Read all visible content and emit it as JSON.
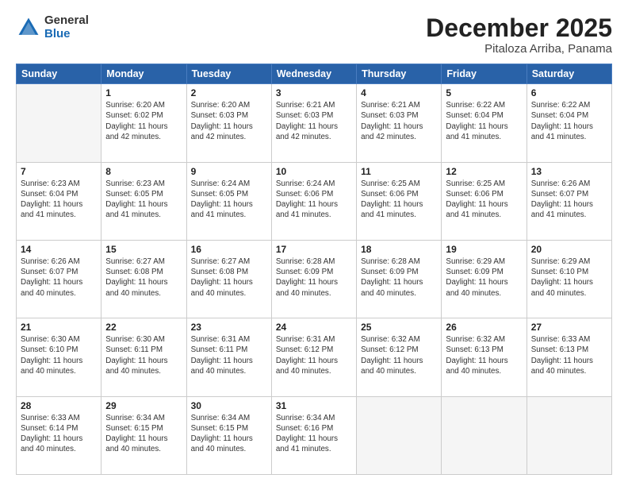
{
  "header": {
    "logo": {
      "general": "General",
      "blue": "Blue"
    },
    "title": "December 2025",
    "subtitle": "Pitaloza Arriba, Panama"
  },
  "weekdays": [
    "Sunday",
    "Monday",
    "Tuesday",
    "Wednesday",
    "Thursday",
    "Friday",
    "Saturday"
  ],
  "weeks": [
    [
      {
        "day": "",
        "info": ""
      },
      {
        "day": "1",
        "info": "Sunrise: 6:20 AM\nSunset: 6:02 PM\nDaylight: 11 hours\nand 42 minutes."
      },
      {
        "day": "2",
        "info": "Sunrise: 6:20 AM\nSunset: 6:03 PM\nDaylight: 11 hours\nand 42 minutes."
      },
      {
        "day": "3",
        "info": "Sunrise: 6:21 AM\nSunset: 6:03 PM\nDaylight: 11 hours\nand 42 minutes."
      },
      {
        "day": "4",
        "info": "Sunrise: 6:21 AM\nSunset: 6:03 PM\nDaylight: 11 hours\nand 42 minutes."
      },
      {
        "day": "5",
        "info": "Sunrise: 6:22 AM\nSunset: 6:04 PM\nDaylight: 11 hours\nand 41 minutes."
      },
      {
        "day": "6",
        "info": "Sunrise: 6:22 AM\nSunset: 6:04 PM\nDaylight: 11 hours\nand 41 minutes."
      }
    ],
    [
      {
        "day": "7",
        "info": "Sunrise: 6:23 AM\nSunset: 6:04 PM\nDaylight: 11 hours\nand 41 minutes."
      },
      {
        "day": "8",
        "info": "Sunrise: 6:23 AM\nSunset: 6:05 PM\nDaylight: 11 hours\nand 41 minutes."
      },
      {
        "day": "9",
        "info": "Sunrise: 6:24 AM\nSunset: 6:05 PM\nDaylight: 11 hours\nand 41 minutes."
      },
      {
        "day": "10",
        "info": "Sunrise: 6:24 AM\nSunset: 6:06 PM\nDaylight: 11 hours\nand 41 minutes."
      },
      {
        "day": "11",
        "info": "Sunrise: 6:25 AM\nSunset: 6:06 PM\nDaylight: 11 hours\nand 41 minutes."
      },
      {
        "day": "12",
        "info": "Sunrise: 6:25 AM\nSunset: 6:06 PM\nDaylight: 11 hours\nand 41 minutes."
      },
      {
        "day": "13",
        "info": "Sunrise: 6:26 AM\nSunset: 6:07 PM\nDaylight: 11 hours\nand 41 minutes."
      }
    ],
    [
      {
        "day": "14",
        "info": "Sunrise: 6:26 AM\nSunset: 6:07 PM\nDaylight: 11 hours\nand 40 minutes."
      },
      {
        "day": "15",
        "info": "Sunrise: 6:27 AM\nSunset: 6:08 PM\nDaylight: 11 hours\nand 40 minutes."
      },
      {
        "day": "16",
        "info": "Sunrise: 6:27 AM\nSunset: 6:08 PM\nDaylight: 11 hours\nand 40 minutes."
      },
      {
        "day": "17",
        "info": "Sunrise: 6:28 AM\nSunset: 6:09 PM\nDaylight: 11 hours\nand 40 minutes."
      },
      {
        "day": "18",
        "info": "Sunrise: 6:28 AM\nSunset: 6:09 PM\nDaylight: 11 hours\nand 40 minutes."
      },
      {
        "day": "19",
        "info": "Sunrise: 6:29 AM\nSunset: 6:09 PM\nDaylight: 11 hours\nand 40 minutes."
      },
      {
        "day": "20",
        "info": "Sunrise: 6:29 AM\nSunset: 6:10 PM\nDaylight: 11 hours\nand 40 minutes."
      }
    ],
    [
      {
        "day": "21",
        "info": "Sunrise: 6:30 AM\nSunset: 6:10 PM\nDaylight: 11 hours\nand 40 minutes."
      },
      {
        "day": "22",
        "info": "Sunrise: 6:30 AM\nSunset: 6:11 PM\nDaylight: 11 hours\nand 40 minutes."
      },
      {
        "day": "23",
        "info": "Sunrise: 6:31 AM\nSunset: 6:11 PM\nDaylight: 11 hours\nand 40 minutes."
      },
      {
        "day": "24",
        "info": "Sunrise: 6:31 AM\nSunset: 6:12 PM\nDaylight: 11 hours\nand 40 minutes."
      },
      {
        "day": "25",
        "info": "Sunrise: 6:32 AM\nSunset: 6:12 PM\nDaylight: 11 hours\nand 40 minutes."
      },
      {
        "day": "26",
        "info": "Sunrise: 6:32 AM\nSunset: 6:13 PM\nDaylight: 11 hours\nand 40 minutes."
      },
      {
        "day": "27",
        "info": "Sunrise: 6:33 AM\nSunset: 6:13 PM\nDaylight: 11 hours\nand 40 minutes."
      }
    ],
    [
      {
        "day": "28",
        "info": "Sunrise: 6:33 AM\nSunset: 6:14 PM\nDaylight: 11 hours\nand 40 minutes."
      },
      {
        "day": "29",
        "info": "Sunrise: 6:34 AM\nSunset: 6:15 PM\nDaylight: 11 hours\nand 40 minutes."
      },
      {
        "day": "30",
        "info": "Sunrise: 6:34 AM\nSunset: 6:15 PM\nDaylight: 11 hours\nand 40 minutes."
      },
      {
        "day": "31",
        "info": "Sunrise: 6:34 AM\nSunset: 6:16 PM\nDaylight: 11 hours\nand 41 minutes."
      },
      {
        "day": "",
        "info": ""
      },
      {
        "day": "",
        "info": ""
      },
      {
        "day": "",
        "info": ""
      }
    ]
  ]
}
